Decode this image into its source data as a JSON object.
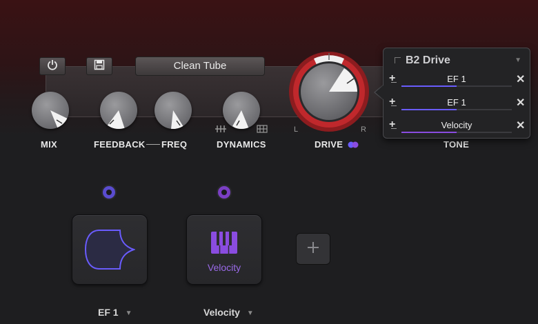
{
  "toolbar": {
    "preset_name": "Clean Tube"
  },
  "knobs": {
    "mix": "MIX",
    "feedback": "FEEDBACK",
    "freq": "FREQ",
    "dynamics": "DYNAMICS",
    "drive": "DRIVE",
    "tone": "TONE",
    "drive_left": "L",
    "drive_right": "R"
  },
  "popup": {
    "title": "B2 Drive",
    "modulators": [
      {
        "label": "EF 1",
        "amount": 0.5,
        "color": "#6a5cff"
      },
      {
        "label": "EF 1",
        "amount": 0.5,
        "color": "#6a5cff"
      },
      {
        "label": "Velocity",
        "amount": 0.5,
        "color": "#8a4ce0"
      }
    ]
  },
  "mod_slots": [
    {
      "name": "EF 1",
      "dot_color": "#5a4ccf"
    },
    {
      "name": "Velocity",
      "dot_color": "#7b3fc4",
      "icon_text": "Velocity"
    }
  ],
  "colors": {
    "accent_blue": "#6a5cff",
    "accent_purple": "#8a4ce0",
    "drive_red": "#c0282c"
  },
  "icons": {
    "power": "power-icon",
    "save": "save-icon",
    "add": "plus-icon",
    "remove": "close-icon"
  }
}
